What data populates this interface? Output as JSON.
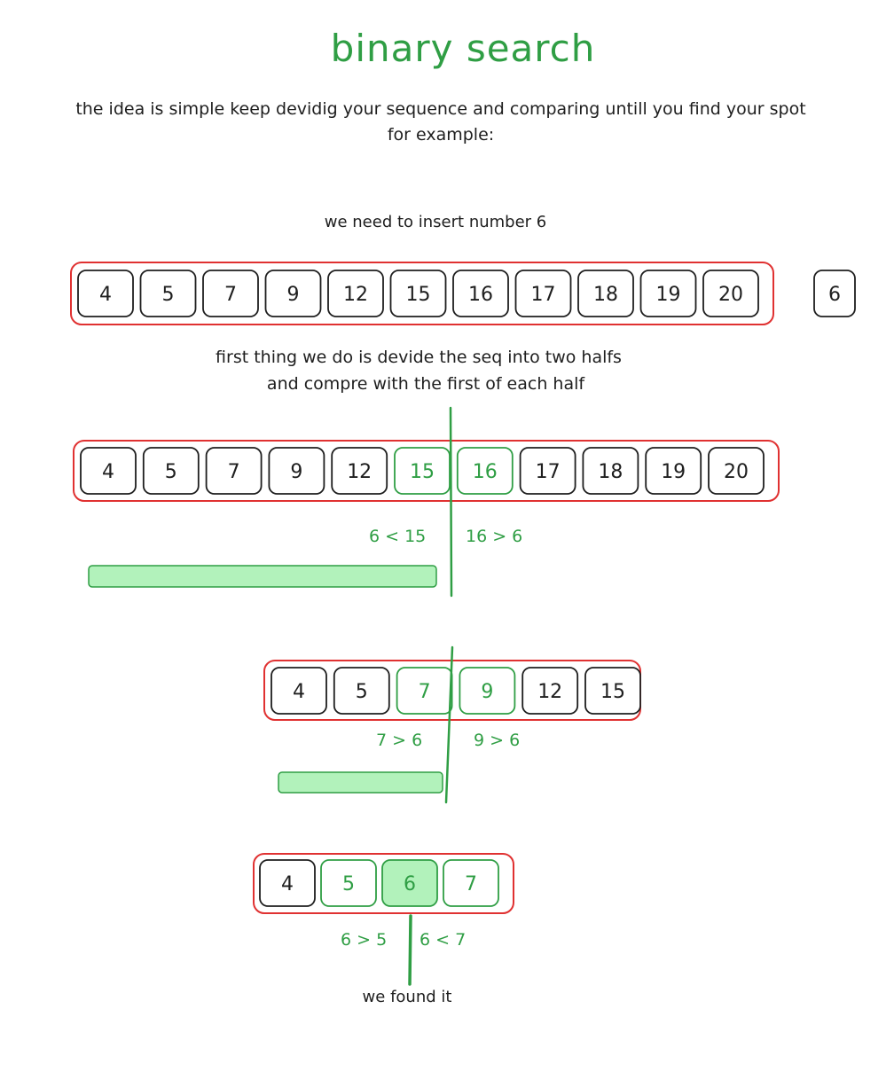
{
  "title": "binary search",
  "intro": [
    "the idea is simple keep devidig your sequence and comparing untill you find your spot",
    "for example:"
  ],
  "task": "we need to insert number 6",
  "target": "6",
  "initial_sequence": [
    "4",
    "5",
    "7",
    "9",
    "12",
    "15",
    "16",
    "17",
    "18",
    "19",
    "20"
  ],
  "step1_text": [
    "first thing we do is devide the seq into two halfs",
    "and compre with the first of each half"
  ],
  "step1_sequence": [
    "4",
    "5",
    "7",
    "9",
    "12",
    "15",
    "16",
    "17",
    "18",
    "19",
    "20"
  ],
  "step1_compare_left": "6 < 15",
  "step1_compare_right": "16 > 6",
  "step2_sequence": [
    "4",
    "5",
    "7",
    "9",
    "12",
    "15"
  ],
  "step2_compare_left": "7 > 6",
  "step2_compare_right": "9 > 6",
  "step3_sequence": [
    "4",
    "5",
    "6",
    "7"
  ],
  "step3_compare_left": "6 > 5",
  "step3_compare_right": "6 < 7",
  "result": "we found it",
  "colors": {
    "stroke": "#1e1e1e",
    "group_border": "#e03131",
    "highlight": "#2f9e44",
    "fill": "#b2f2bb"
  }
}
